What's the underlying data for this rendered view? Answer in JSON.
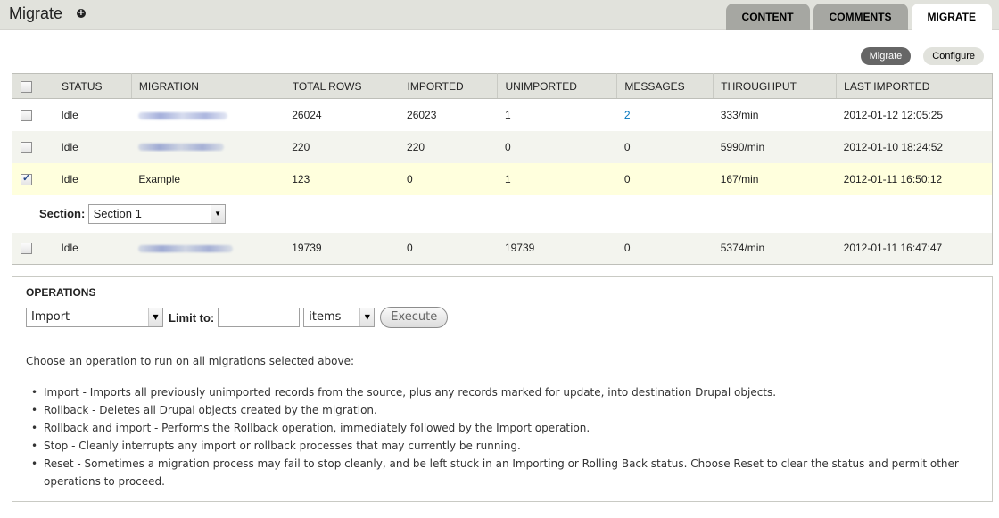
{
  "header": {
    "title": "Migrate",
    "add_icon": "plus-circle-icon",
    "tabs": [
      {
        "label": "CONTENT",
        "active": false
      },
      {
        "label": "COMMENTS",
        "active": false
      },
      {
        "label": "MIGRATE",
        "active": true
      }
    ]
  },
  "actions": {
    "migrate": "Migrate",
    "configure": "Configure"
  },
  "table": {
    "headers": [
      "STATUS",
      "MIGRATION",
      "TOTAL ROWS",
      "IMPORTED",
      "UNIMPORTED",
      "MESSAGES",
      "THROUGHPUT",
      "LAST IMPORTED"
    ],
    "rows": [
      {
        "checked": false,
        "status": "Idle",
        "migration": "",
        "total_rows": "26024",
        "imported": "26023",
        "unimported": "1",
        "messages": "2",
        "throughput": "333/min",
        "last_imported": "2012-01-12 12:05:25"
      },
      {
        "checked": false,
        "status": "Idle",
        "migration": "",
        "total_rows": "220",
        "imported": "220",
        "unimported": "0",
        "messages": "0",
        "throughput": "5990/min",
        "last_imported": "2012-01-10 18:24:52"
      },
      {
        "checked": true,
        "status": "Idle",
        "migration": "Example",
        "total_rows": "123",
        "imported": "0",
        "unimported": "1",
        "messages": "0",
        "throughput": "167/min",
        "last_imported": "2012-01-11 16:50:12"
      },
      {
        "checked": false,
        "status": "Idle",
        "migration": "",
        "total_rows": "19739",
        "imported": "0",
        "unimported": "19739",
        "messages": "0",
        "throughput": "5374/min",
        "last_imported": "2012-01-11 16:47:47"
      }
    ],
    "section": {
      "label": "Section:",
      "value": "Section 1"
    }
  },
  "operations": {
    "title": "OPERATIONS",
    "operation_value": "Import",
    "limit_label": "Limit to:",
    "limit_value": "",
    "unit_value": "items",
    "execute_label": "Execute",
    "description": "Choose an operation to run on all migrations selected above:",
    "items": [
      "Import - Imports all previously unimported records from the source, plus any records marked for update, into destination Drupal objects.",
      "Rollback - Deletes all Drupal objects created by the migration.",
      "Rollback and import - Performs the Rollback operation, immediately followed by the Import operation.",
      "Stop - Cleanly interrupts any import or rollback processes that may currently be running.",
      "Reset - Sometimes a migration process may fail to stop cleanly, and be left stuck in an Importing or Rolling Back status. Choose Reset to clear the status and permit other operations to proceed."
    ]
  }
}
